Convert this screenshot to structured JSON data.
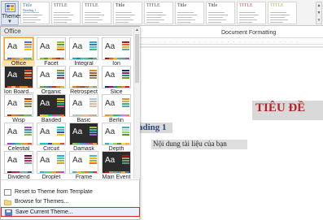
{
  "toolbar": {
    "themes_label": "Themes"
  },
  "gallery": {
    "styles": [
      {
        "title": "Title",
        "heading": "Heading 1",
        "color": "#2e74b5"
      },
      {
        "title": "TITLE",
        "heading": "",
        "color": "#555555"
      },
      {
        "title": "TITLE",
        "heading": "",
        "color": "#555555"
      },
      {
        "title": "Title",
        "heading": "",
        "color": "#222222"
      },
      {
        "title": "TITLE",
        "heading": "",
        "color": "#555555"
      },
      {
        "title": "Title",
        "heading": "",
        "color": "#333333"
      },
      {
        "title": "Title",
        "heading": "",
        "color": "#333333"
      },
      {
        "title": "TITLE",
        "heading": "",
        "color": "#c0504d"
      },
      {
        "title": "TITLE",
        "heading": "",
        "color": "#9bbb59"
      }
    ]
  },
  "document": {
    "title": "Document Formatting",
    "big_title": "TIÊU ĐỀ",
    "heading": "ading 1",
    "body": "Nội dung tài liệu của bạn"
  },
  "panel": {
    "section_header": "Office",
    "themes": [
      {
        "name": "Office",
        "selected": true,
        "colors": [
          "#4472c4",
          "#ed7d31",
          "#a5a5a5",
          "#ffc000",
          "#5b9bd5",
          "#70ad47"
        ]
      },
      {
        "name": "Facet",
        "selected": false,
        "colors": [
          "#90c226",
          "#54a021",
          "#e6b91e",
          "#e76618",
          "#c42f1a",
          "#918655"
        ]
      },
      {
        "name": "Integral",
        "selected": false,
        "colors": [
          "#1cade4",
          "#2683c6",
          "#27ced7",
          "#42ba97",
          "#3e8853",
          "#62a39f"
        ]
      },
      {
        "name": "Ion",
        "selected": false,
        "colors": [
          "#b01513",
          "#ea6312",
          "#e6b729",
          "#6aac90",
          "#5f9c9d",
          "#9e5e9b"
        ]
      },
      {
        "name": "Ion Board...",
        "selected": false,
        "colors": [
          "#e84c22",
          "#ffbd47",
          "#b64926",
          "#ff8427",
          "#cc9900",
          "#b22600"
        ]
      },
      {
        "name": "Organic",
        "selected": false,
        "colors": [
          "#83992a",
          "#3c9770",
          "#44709d",
          "#a23c33",
          "#d97828",
          "#deb340"
        ]
      },
      {
        "name": "Retrospect",
        "selected": false,
        "colors": [
          "#e48312",
          "#bd582c",
          "#865640",
          "#9b8357",
          "#c2bc80",
          "#94a088"
        ]
      },
      {
        "name": "Slice",
        "selected": false,
        "colors": [
          "#052f61",
          "#a50e82",
          "#14967c",
          "#6a9e1f",
          "#e87d37",
          "#c62324"
        ]
      },
      {
        "name": "Wisp",
        "selected": false,
        "colors": [
          "#a53010",
          "#de7e18",
          "#9f8351",
          "#728653",
          "#92aa4c",
          "#6aac91"
        ]
      },
      {
        "name": "Banded",
        "selected": false,
        "colors": [
          "#ffc000",
          "#a5d028",
          "#08cc78",
          "#f24099",
          "#828288",
          "#f56617"
        ]
      },
      {
        "name": "Basic",
        "selected": false,
        "colors": [
          "#a8cdd7",
          "#c0beaf",
          "#cec597",
          "#e8b7b7",
          "#dfab77",
          "#b2b2b2"
        ]
      },
      {
        "name": "Berlin",
        "selected": false,
        "colors": [
          "#f09415",
          "#c1b56b",
          "#4baf73",
          "#5aa6c0",
          "#d17df9",
          "#fa7e5c"
        ]
      },
      {
        "name": "Celestial",
        "selected": false,
        "colors": [
          "#ac3ec1",
          "#477bd1",
          "#46b298",
          "#90ba4c",
          "#dd9d31",
          "#e25247"
        ]
      },
      {
        "name": "Circuit",
        "selected": false,
        "colors": [
          "#03d4a8",
          "#21c5e3",
          "#3a4b9f",
          "#dfc722",
          "#f5b02f",
          "#db4d3d"
        ]
      },
      {
        "name": "Damask",
        "selected": false,
        "colors": [
          "#9ec544",
          "#50bea3",
          "#4a9ccc",
          "#9a66ca",
          "#c54f71",
          "#de9c3c"
        ]
      },
      {
        "name": "Depth",
        "selected": false,
        "colors": [
          "#41aebd",
          "#97e9d5",
          "#a2cf49",
          "#608f3d",
          "#f4de3a",
          "#fcb11c"
        ]
      },
      {
        "name": "Dividend",
        "selected": false,
        "colors": [
          "#4d1434",
          "#903163",
          "#b2324b",
          "#969fa7",
          "#66b1ce",
          "#40619d"
        ]
      },
      {
        "name": "Droplet",
        "selected": false,
        "colors": [
          "#2fa3ee",
          "#4bcaad",
          "#86c157",
          "#d99c3f",
          "#ce6633",
          "#a35dd1"
        ]
      },
      {
        "name": "Frame",
        "selected": false,
        "colors": [
          "#40bad2",
          "#fab900",
          "#90bb23",
          "#ee7008",
          "#1ab39f",
          "#d5393d"
        ]
      },
      {
        "name": "Main Event",
        "selected": false,
        "colors": [
          "#b80e0f",
          "#a6987d",
          "#7f9a71",
          "#64908a",
          "#e8a239",
          "#3c7aa0"
        ]
      }
    ],
    "menu": [
      {
        "label": "Reset to Theme from Template",
        "name": "reset-theme-item"
      },
      {
        "label": "Browse for Themes...",
        "name": "browse-themes-item"
      },
      {
        "label": "Save Current Theme...",
        "name": "save-current-theme-item"
      }
    ],
    "colors": {
      "highlight": "#d9262c",
      "selection": "#f0a030"
    }
  }
}
